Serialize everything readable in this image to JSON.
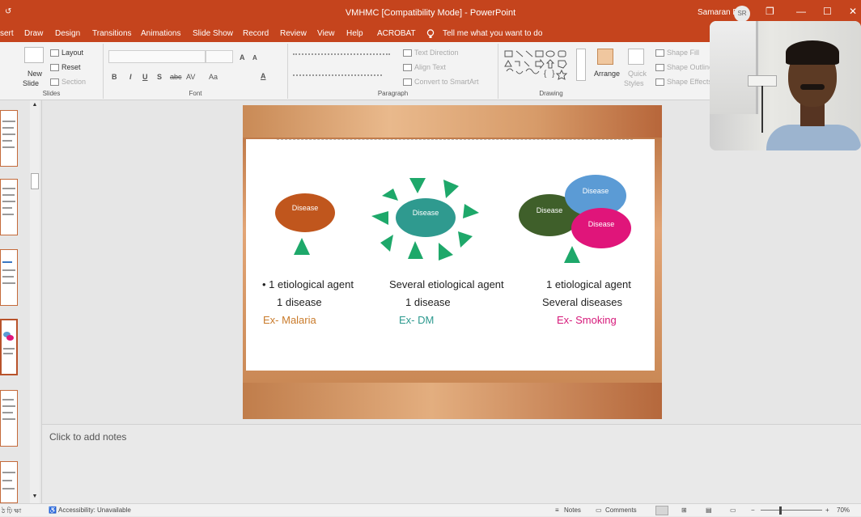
{
  "titlebar": {
    "qat": "↺",
    "title": "VMHMC [Compatibility Mode] - PowerPoint",
    "user": "Samaran R",
    "initials": "SR",
    "restore": "❐",
    "minimize": "—",
    "maximize": "☐",
    "close": "✕"
  },
  "menu": [
    "sert",
    "Draw",
    "Design",
    "Transitions",
    "Animations",
    "Slide Show",
    "Record",
    "Review",
    "View",
    "Help",
    "ACROBAT"
  ],
  "tellme": "Tell me what you want to do",
  "ribbon": {
    "slides": {
      "new": "New",
      "slide": "Slide",
      "layout": "Layout",
      "reset": "Reset",
      "section": "Section",
      "label": "Slides"
    },
    "font": {
      "bold": "B",
      "italic": "I",
      "underline": "U",
      "shadow": "S",
      "strike": "abc",
      "spacing": "AV",
      "case": "Aa",
      "color": "A",
      "grow": "A",
      "shrink": "A",
      "label": "Font"
    },
    "paragraph": {
      "text_direction": "Text Direction",
      "align_text": "Align Text",
      "smartart": "Convert to SmartArt",
      "label": "Paragraph"
    },
    "drawing": {
      "arrange": "Arrange",
      "quick": "Quick",
      "styles": "Styles",
      "fill": "Shape Fill",
      "outline": "Shape Outline",
      "effects": "Shape Effects",
      "label": "Drawing"
    }
  },
  "slide": {
    "diagram1": {
      "ellipse": "Disease",
      "caption1": "• 1 etiological agent",
      "caption2": "1 disease",
      "example": "Ex- Malaria"
    },
    "diagram2": {
      "ellipse": "Disease",
      "caption1": "Several etiological agent",
      "caption2": "1 disease",
      "example": "Ex- DM"
    },
    "diagram3": {
      "ellipse_dark": "Disease",
      "ellipse_blue": "Disease",
      "ellipse_pink": "Disease",
      "caption1": "1 etiological agent",
      "caption2": "Several diseases",
      "example": "Ex- Smoking"
    },
    "colors": {
      "orange": "#c0561d",
      "teal": "#2f9a8f",
      "darkgreen": "#3f5f2a",
      "blue": "#5b9bd5",
      "pink": "#e0157a",
      "triangle": "#1ea86a",
      "malaria": "#c97b2b",
      "dm": "#2d9a8f",
      "smoking": "#d6197a"
    }
  },
  "notes_placeholder": "Click to add notes",
  "status": {
    "slide": "ঠ ঢ়ি ক্ষা",
    "accessibility": "Accessibility: Unavailable",
    "notes": "Notes",
    "comments": "Comments",
    "zoom": "70%",
    "minus": "−",
    "plus": "+"
  }
}
